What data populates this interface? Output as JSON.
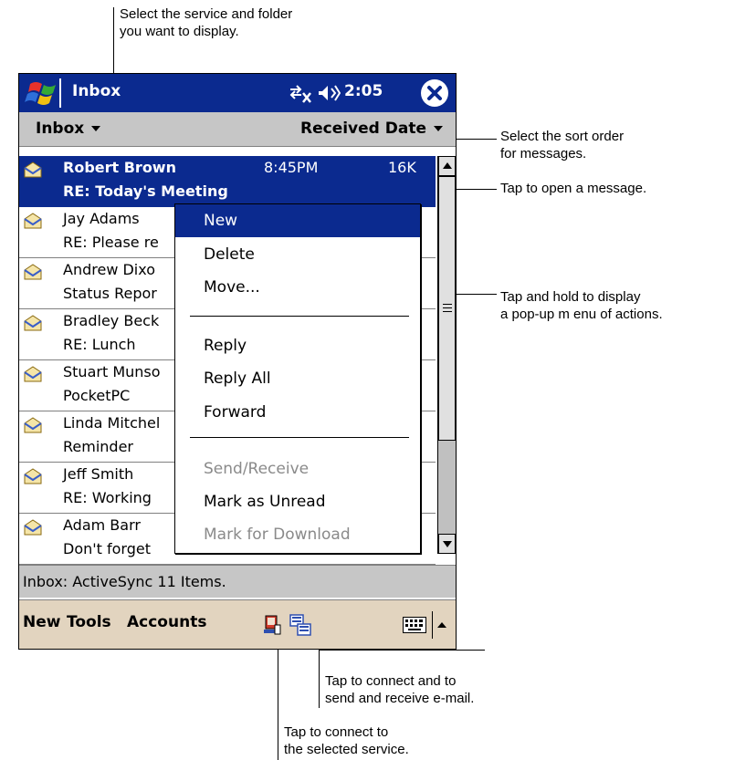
{
  "callouts": {
    "folder": [
      "Select the service and folder",
      "you want to display."
    ],
    "sort": [
      "Select the sort order",
      "for messages."
    ],
    "open": "Tap to open a message.",
    "hold": [
      "Tap and hold to display",
      "a pop-up m enu of actions."
    ],
    "sendrecv": [
      "Tap to connect and to",
      "send and receive e-mail."
    ],
    "connect": [
      "Tap to connect to",
      "the selected service."
    ]
  },
  "titlebar": {
    "app_title": "Inbox",
    "clock": "2:05",
    "start_icon": "windows-flag-icon",
    "connection_icon": "connectivity-icon",
    "volume_icon": "speaker-icon",
    "close_icon": "close-icon"
  },
  "header": {
    "folder": "Inbox",
    "sort": "Received Date"
  },
  "messages": [
    {
      "sender": "Robert Brown",
      "subject": "RE: Today's Meeting",
      "time": "8:45PM",
      "size": "16K",
      "selected": true
    },
    {
      "sender": "Jay Adams",
      "subject": "RE: Please re"
    },
    {
      "sender": "Andrew Dixo",
      "subject": "Status Repor"
    },
    {
      "sender": "Bradley Beck",
      "subject": "RE: Lunch"
    },
    {
      "sender": "Stuart Munso",
      "subject": "PocketPC"
    },
    {
      "sender": "Linda Mitchel",
      "subject": "Reminder"
    },
    {
      "sender": "Jeff Smith",
      "subject": "RE: Working"
    },
    {
      "sender": "Adam Barr",
      "subject": "Don't forget"
    }
  ],
  "popup_menu": {
    "items": [
      {
        "label": "New",
        "state": "highlighted"
      },
      {
        "label": "Delete",
        "state": "normal"
      },
      {
        "label": "Move...",
        "state": "normal"
      },
      {
        "label": "Reply",
        "state": "normal"
      },
      {
        "label": "Reply All",
        "state": "normal"
      },
      {
        "label": "Forward",
        "state": "normal"
      },
      {
        "label": "Send/Receive",
        "state": "disabled"
      },
      {
        "label": "Mark as Unread",
        "state": "normal"
      },
      {
        "label": "Mark for Download",
        "state": "disabled"
      }
    ]
  },
  "status": "Inbox: ActiveSync  11 Items.",
  "menubar": {
    "new": "New",
    "tools": "Tools",
    "accounts": "Accounts",
    "connect_icon": "connect-icon",
    "sendrecv_icon": "send-receive-icon",
    "keyboard_icon": "keyboard-icon"
  },
  "colors": {
    "title_blue": "#0b2a8f",
    "bar_gray": "#c6c6c6",
    "menubar_tan": "#e2d4bf",
    "disabled": "#8a8a8a"
  }
}
